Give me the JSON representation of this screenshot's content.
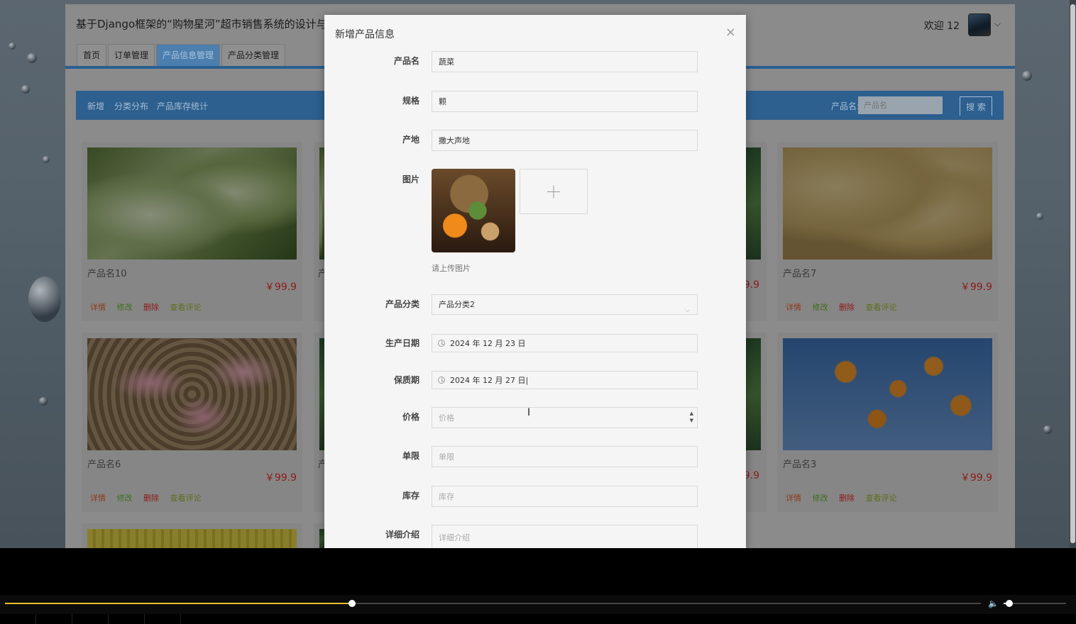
{
  "app": {
    "title": "基于Django框架的“购物星河”超市销售系统的设计与实现",
    "welcome": "欢迎 12",
    "avatar_chevron": "⌵"
  },
  "nav": {
    "tabs": [
      "首页",
      "订单管理",
      "产品信息管理",
      "产品分类管理"
    ],
    "active_index": 2
  },
  "toolbar": {
    "links": [
      "新增",
      "分类分布",
      "产品库存统计"
    ],
    "search_label": "产品名:",
    "search_placeholder": "产品名",
    "search_button": "搜 索"
  },
  "cards": [
    {
      "name": "产品名10",
      "price": "￥99.9",
      "image": "cabbage"
    },
    {
      "name": "产品名7",
      "price": "￥99.9",
      "image": "potato"
    },
    {
      "name": "产品名6",
      "price": "￥99.9",
      "image": "peanut"
    },
    {
      "name": "产品名3",
      "price": "￥99.9",
      "image": "persimmon"
    }
  ],
  "card_actions": {
    "detail": "详情",
    "edit": "修改",
    "delete": "删除",
    "comments": "查看评论"
  },
  "partial_cards": {
    "price_suffix": "9.9",
    "prefix": "产"
  },
  "modal": {
    "title": "新增产品信息",
    "close": "×",
    "fields": {
      "name": {
        "label": "产品名",
        "value": "蔬菜"
      },
      "spec": {
        "label": "规格",
        "value": "颗"
      },
      "origin": {
        "label": "产地",
        "value": "撒大声地"
      },
      "image": {
        "label": "图片",
        "hint": "请上传图片"
      },
      "category": {
        "label": "产品分类",
        "value": "产品分类2",
        "chevron": "⌵"
      },
      "prod_date": {
        "label": "生产日期",
        "value": "2024 年 12 月 23 日"
      },
      "shelf_life": {
        "label": "保质期",
        "value": "2024 年 12 月 27 日|"
      },
      "price": {
        "label": "价格",
        "placeholder": "价格",
        "spin_up": "▲",
        "spin_down": "▼"
      },
      "unit_limit": {
        "label": "单限",
        "placeholder": "单限"
      },
      "stock": {
        "label": "库存",
        "placeholder": "库存"
      },
      "details": {
        "label": "详细介绍",
        "placeholder": "详细介绍"
      }
    }
  },
  "player": {
    "progress": 0.356,
    "volume": 0.09,
    "volume_icon": "🔈"
  },
  "colors": {
    "accent": "#2d5f8f",
    "price": "#8e1a1a",
    "progress": "#e8c02a"
  }
}
